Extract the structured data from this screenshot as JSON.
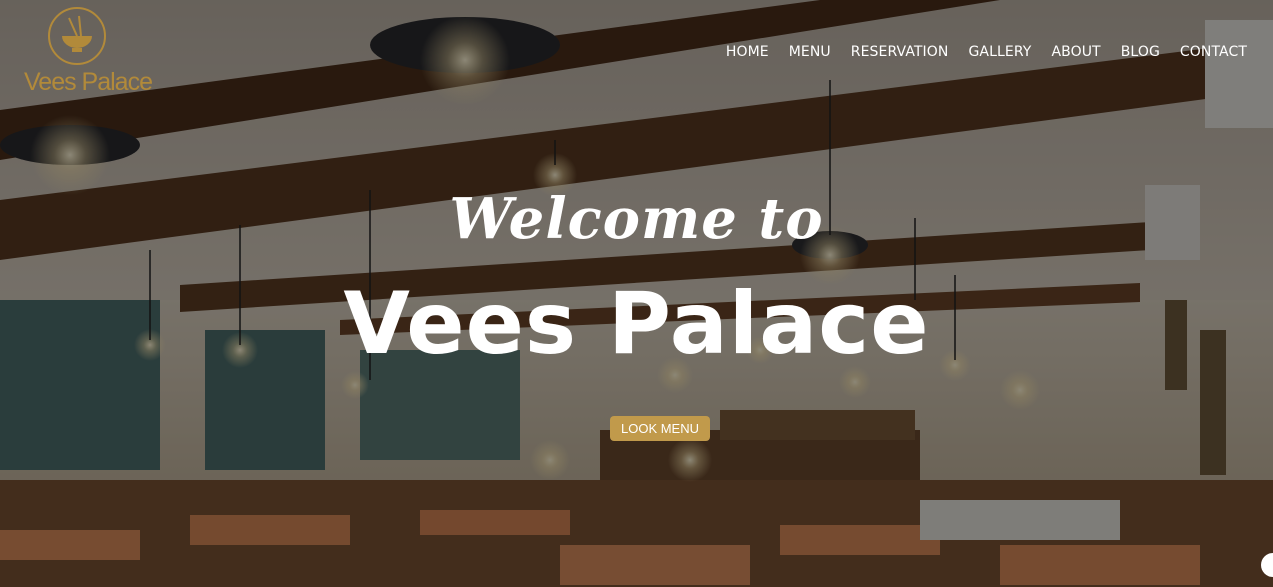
{
  "brand": {
    "name": "Vees Palace",
    "accent_color": "#b28a3a",
    "logo_icon": "noodle-bowl-icon"
  },
  "nav": {
    "items": [
      {
        "label": "HOME"
      },
      {
        "label": "MENU"
      },
      {
        "label": "RESERVATION"
      },
      {
        "label": "GALLERY"
      },
      {
        "label": "ABOUT"
      },
      {
        "label": "BLOG"
      },
      {
        "label": "CONTACT"
      }
    ]
  },
  "hero": {
    "welcome": "Welcome to",
    "title": "Vees Palace",
    "cta_label": "LOOK MENU",
    "cta_color": "#c19a4b"
  }
}
